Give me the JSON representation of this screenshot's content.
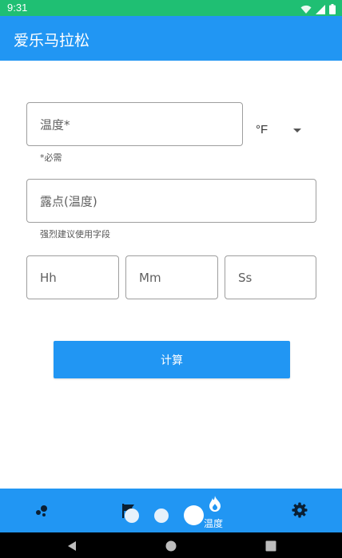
{
  "status_bar": {
    "time": "9:31",
    "icons": [
      "wifi-icon",
      "signal-icon",
      "battery-icon"
    ]
  },
  "app_bar": {
    "title": "爱乐马拉松"
  },
  "form": {
    "temperature": {
      "placeholder": "温度*",
      "helper": "*必需"
    },
    "unit": {
      "selected": "°F"
    },
    "dew_point": {
      "placeholder": "露点(温度)",
      "helper": "强烈建议使用字段"
    },
    "time": {
      "hours_placeholder": "Hh",
      "minutes_placeholder": "Mm",
      "seconds_placeholder": "Ss"
    },
    "calculate_label": "计算"
  },
  "bottom_nav": {
    "items": [
      {
        "icon": "scatter-icon"
      },
      {
        "icon": "flag-icon"
      },
      {
        "icon": "flame-icon",
        "label": "温度"
      },
      {
        "icon": "gear-icon"
      }
    ]
  },
  "colors": {
    "primary": "#2196f3",
    "status_bar": "#1fbf73"
  },
  "system_nav": {
    "icons": [
      "back-icon",
      "home-icon",
      "recents-icon"
    ]
  }
}
